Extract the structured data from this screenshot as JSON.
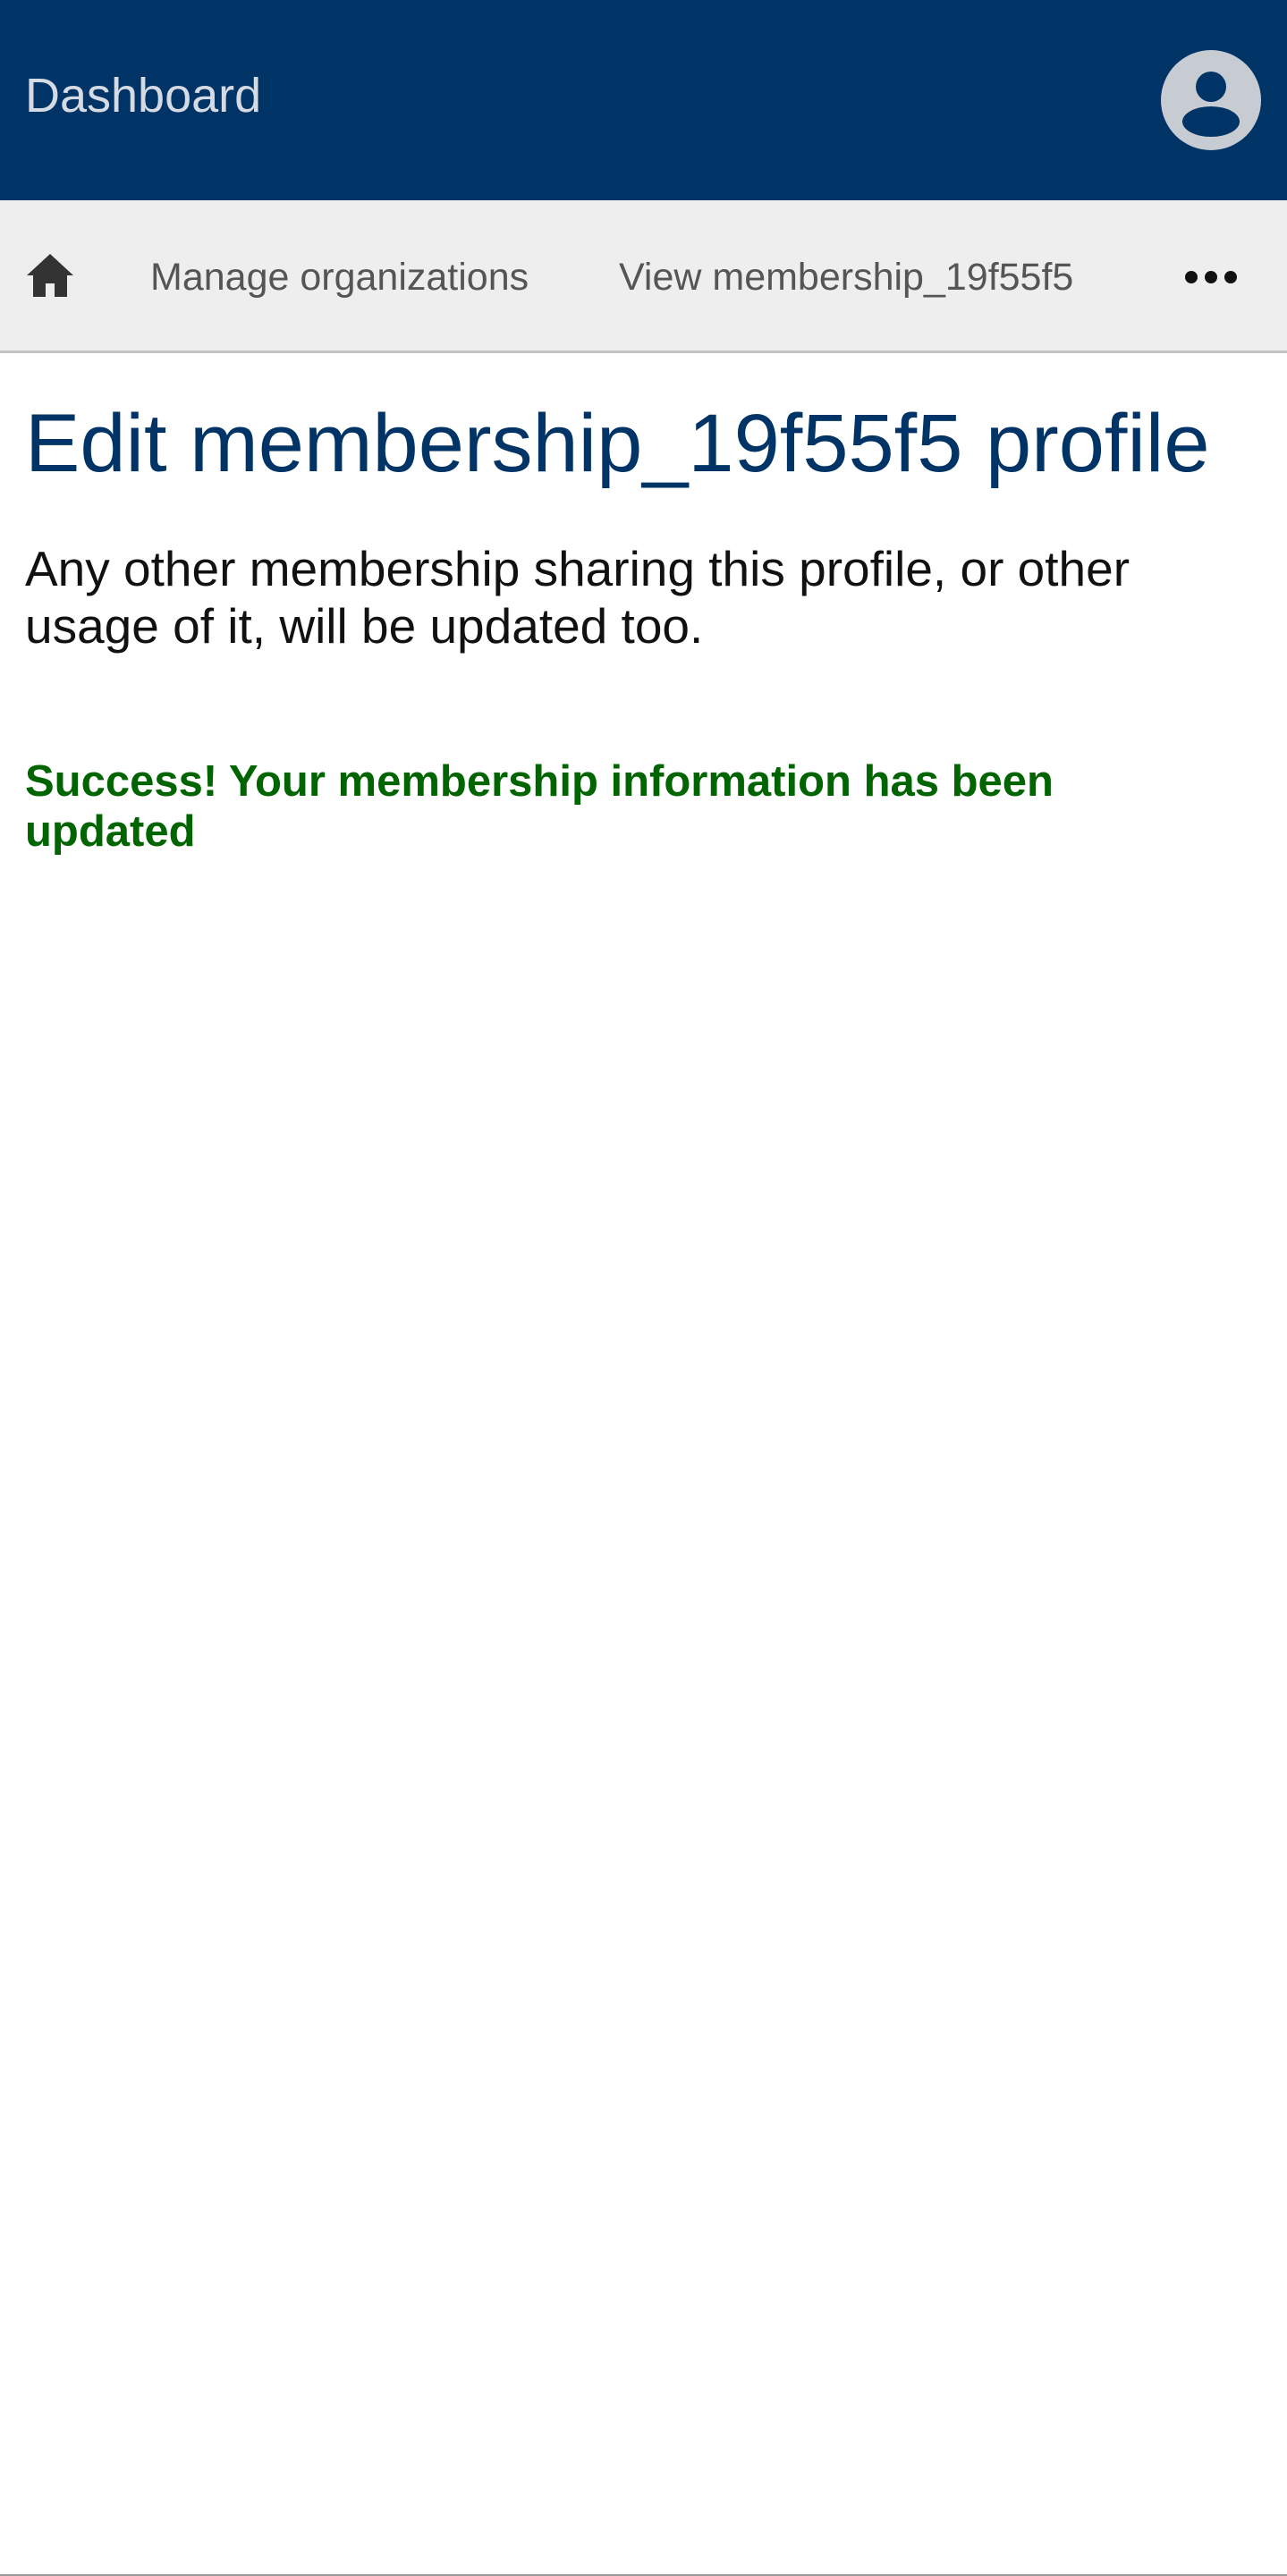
{
  "header": {
    "title": "Dashboard",
    "avatar_icon": "user-circle-icon",
    "background_color": "#003366"
  },
  "nav": {
    "home_icon": "home-icon",
    "items": [
      {
        "label": "Manage organizations"
      },
      {
        "label": "View membership_19f55f5"
      }
    ],
    "more_icon": "ellipsis-icon"
  },
  "main": {
    "title": "Edit membership_19f55f5 profile",
    "intro": "Any other membership sharing this profile, or other usage of it, will be updated too.",
    "success_message": "Success! Your membership information has been updated",
    "title_color": "#003366",
    "success_color": "#006400"
  }
}
